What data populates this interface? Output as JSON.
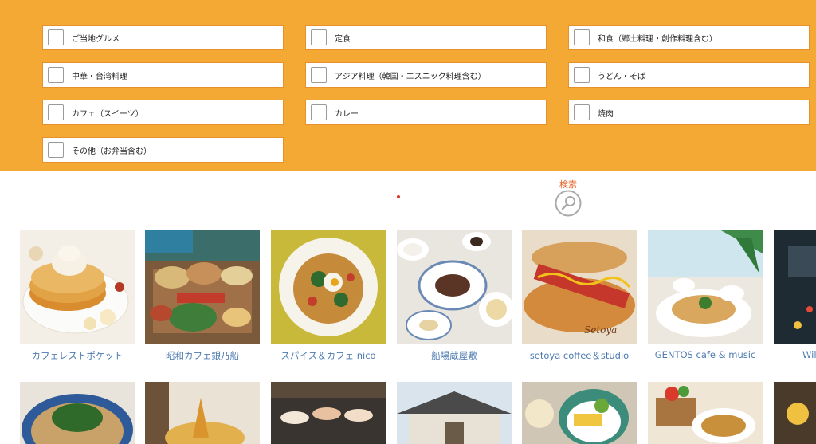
{
  "filters": {
    "options": [
      {
        "label": "ご当地グルメ"
      },
      {
        "label": "定食"
      },
      {
        "label": "和食（郷土料理・創作料理含む）"
      },
      {
        "label": "中華・台湾料理"
      },
      {
        "label": "アジア料理（韓国・エスニック料理含む）"
      },
      {
        "label": "うどん・そば"
      },
      {
        "label": "カフェ（スイーツ）"
      },
      {
        "label": "カレー"
      },
      {
        "label": "焼肉"
      },
      {
        "label": "その他（お弁当含む）"
      }
    ]
  },
  "search": {
    "label": "検索",
    "icon": "magnifier-icon"
  },
  "colors": {
    "panel": "#f3a933",
    "accent": "#e8652b",
    "link": "#4d7bb0"
  },
  "restaurants": [
    {
      "name": "カフェレストポケット"
    },
    {
      "name": "昭和カフェ銀乃船"
    },
    {
      "name": "スパイス＆カフェ nico"
    },
    {
      "name": "船場蔵屋敷"
    },
    {
      "name": "setoya coffee＆studio"
    },
    {
      "name": "GENTOS cafe & music"
    },
    {
      "name": "Wil"
    }
  ]
}
